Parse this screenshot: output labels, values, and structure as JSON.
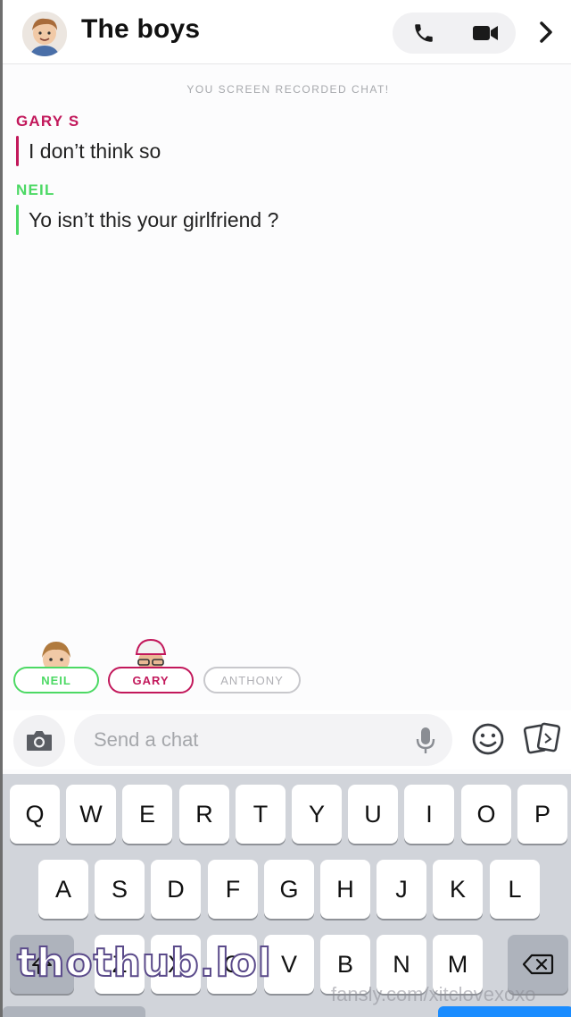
{
  "header": {
    "title": "The boys",
    "avatar_icon": "group-bitmoji-avatar",
    "call_icon": "phone-icon",
    "video_icon": "video-camera-icon",
    "more_icon": "chevron-right-icon"
  },
  "system_note": "YOU SCREEN RECORDED CHAT!",
  "messages": [
    {
      "sender": "GARY S",
      "text": "I don’t think so",
      "color": "#c2185b"
    },
    {
      "sender": "NEIL",
      "text": "Yo isn’t this your girlfriend ?",
      "color": "#4cd964"
    }
  ],
  "presence": [
    {
      "name": "NEIL",
      "color": "#4cd964"
    },
    {
      "name": "GARY",
      "color": "#c2185b"
    },
    {
      "name": "ANTHONY",
      "color": "#c8c8cc"
    }
  ],
  "input": {
    "placeholder": "Send a chat",
    "camera_icon": "camera-icon",
    "mic_icon": "microphone-icon",
    "emoji_icon": "emoji-icon",
    "sticker_icon": "sticker-cards-icon"
  },
  "keyboard": {
    "row1": [
      "Q",
      "W",
      "E",
      "R",
      "T",
      "Y",
      "U",
      "I",
      "O",
      "P"
    ],
    "row2": [
      "A",
      "S",
      "D",
      "F",
      "G",
      "H",
      "J",
      "K",
      "L"
    ],
    "row3": [
      "Z",
      "X",
      "C",
      "V",
      "B",
      "N",
      "M"
    ],
    "shift_icon": "shift-icon",
    "delete_icon": "backspace-icon"
  },
  "watermarks": {
    "primary": "thothub.lol",
    "secondary": "fansly.com/xitclovexoxo"
  }
}
